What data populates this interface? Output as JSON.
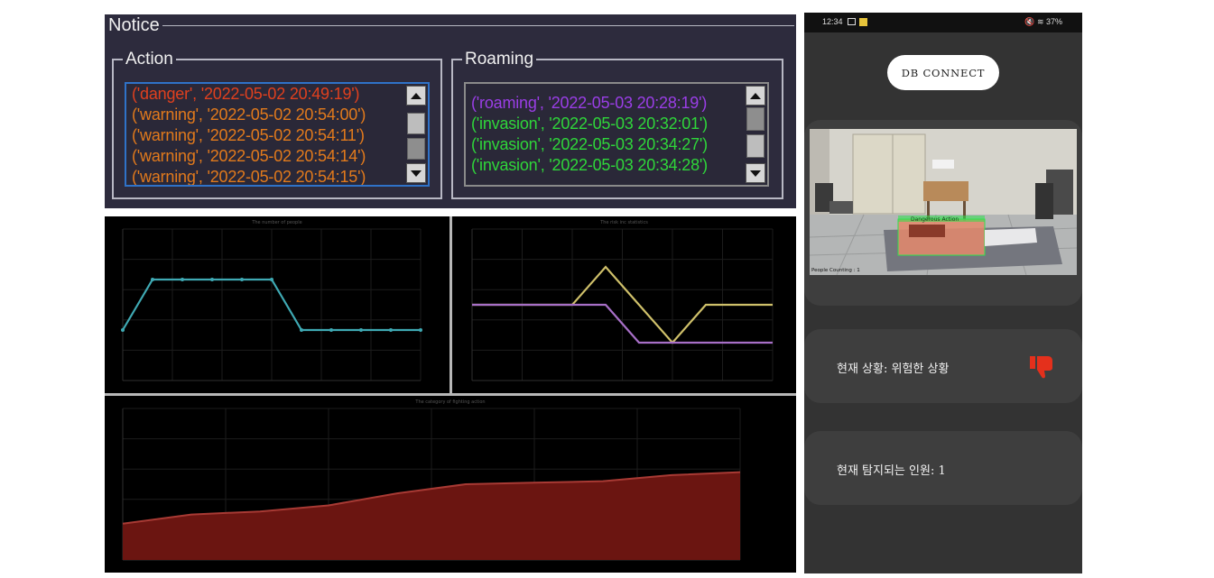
{
  "notice": {
    "title": "Notice",
    "action": {
      "title": "Action",
      "lines": [
        {
          "text": "('danger', '2022-05-02 20:49:19')",
          "color": "#e0401e"
        },
        {
          "text": "('warning', '2022-05-02 20:54:00')",
          "color": "#e27a1c"
        },
        {
          "text": "('warning', '2022-05-02 20:54:11')",
          "color": "#e27a1c"
        },
        {
          "text": "('warning', '2022-05-02 20:54:14')",
          "color": "#e27a1c"
        },
        {
          "text": "('warning', '2022-05-02 20:54:15')",
          "color": "#e27a1c"
        }
      ]
    },
    "roaming": {
      "title": "Roaming",
      "lines": [
        {
          "text": "('roaming', '2022-05-03 20:28:19')",
          "color": "#9a3ee6"
        },
        {
          "text": "('invasion', '2022-05-03 20:32:01')",
          "color": "#2fd63a"
        },
        {
          "text": "('invasion', '2022-05-03 20:34:27')",
          "color": "#2fd63a"
        },
        {
          "text": "('invasion', '2022-05-03 20:34:28')",
          "color": "#2fd63a"
        }
      ]
    }
  },
  "chart_data": [
    {
      "type": "line",
      "title": "The number of people",
      "x": [
        0,
        1,
        2,
        3,
        4,
        5,
        6,
        7,
        8,
        9,
        10
      ],
      "series": [
        {
          "values": [
            3,
            4,
            4,
            4,
            4,
            4,
            3,
            3,
            3,
            3,
            3
          ],
          "color": "#3fa9b3"
        }
      ],
      "grid": true
    },
    {
      "type": "line",
      "title": "The risk inc statistics",
      "x": [
        0,
        1,
        2,
        3,
        4,
        5,
        6,
        7,
        8,
        9
      ],
      "series": [
        {
          "values": [
            2,
            2,
            2,
            2,
            3,
            2,
            1,
            2,
            2,
            2
          ],
          "color": "#cfc06a"
        },
        {
          "values": [
            2,
            2,
            2,
            2,
            2,
            1,
            1,
            1,
            1,
            1
          ],
          "color": "#a76fc7"
        }
      ],
      "grid": true
    },
    {
      "type": "area",
      "title": "The category of fighting action",
      "x": [
        0,
        1,
        2,
        3,
        4,
        5,
        6,
        7,
        8,
        9
      ],
      "series": [
        {
          "values": [
            1.2,
            1.5,
            1.6,
            1.8,
            2.2,
            2.5,
            2.55,
            2.6,
            2.8,
            2.9
          ],
          "color": "#a83a34"
        }
      ],
      "ylim": [
        0,
        5
      ],
      "grid": true
    }
  ],
  "phone": {
    "status_time": "12:34",
    "status_right": "🔇 ≋ 37%",
    "db_button": "DB CONNECT",
    "video_overlay_label": "Dangerous Action",
    "people_counting": "People Counting : 1",
    "status_text": "현재 상황:  위험한 상황",
    "count_text": "현재 탐지되는 인원:  1",
    "status_icon": "thumbs-down-icon",
    "status_icon_color": "#e4301c"
  }
}
